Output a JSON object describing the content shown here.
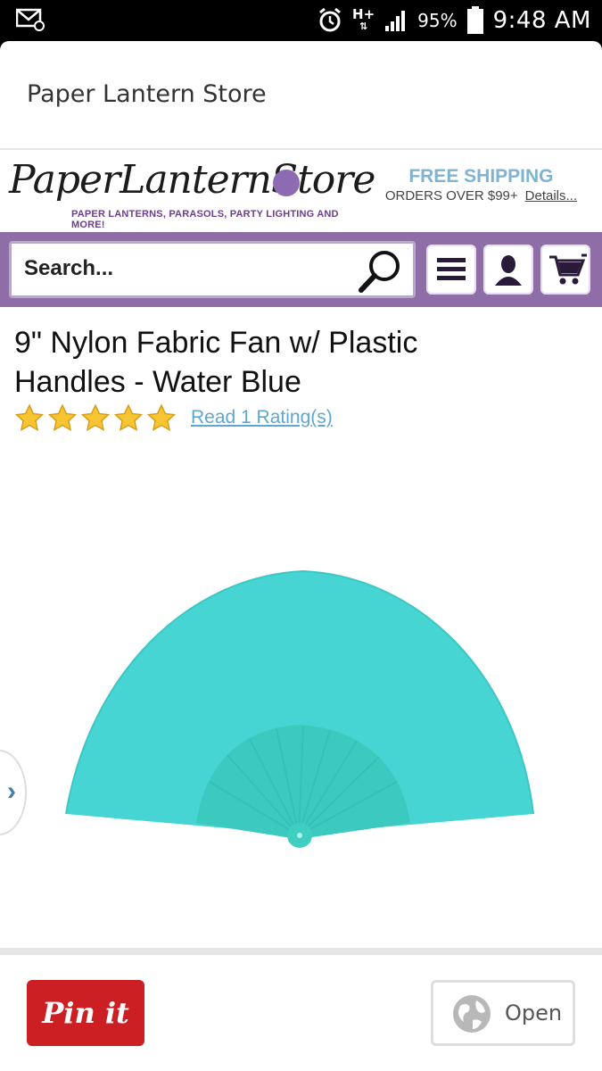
{
  "status_bar": {
    "battery": "95%",
    "time": "9:48 AM",
    "network": "H+"
  },
  "card": {
    "title": "Paper Lantern Store"
  },
  "site": {
    "logo_text": "PaperLanternStore",
    "logo_tagline": "PAPER LANTERNS, PARASOLS, PARTY LIGHTING AND MORE!",
    "shipping_title": "FREE SHIPPING",
    "shipping_sub": "ORDERS OVER $99+",
    "shipping_link": "Details...",
    "search_placeholder": "Search...",
    "colors": {
      "nav_bar": "#8f6ea8",
      "accent_blue": "#5ea7cf",
      "fan": "#44d4d0"
    }
  },
  "product": {
    "title": "9\" Nylon Fabric Fan w/ Plastic Handles - Water Blue",
    "rating_stars": 5,
    "rating_link": "Read 1 Rating(s)"
  },
  "actions": {
    "pin_label": "Pin it",
    "open_label": "Open"
  },
  "icons": [
    "email-notification-icon",
    "alarm-icon",
    "signal-icon",
    "battery-icon",
    "search-icon",
    "menu-icon",
    "account-icon",
    "cart-icon",
    "chevron-right-icon",
    "globe-icon",
    "star-icon"
  ]
}
